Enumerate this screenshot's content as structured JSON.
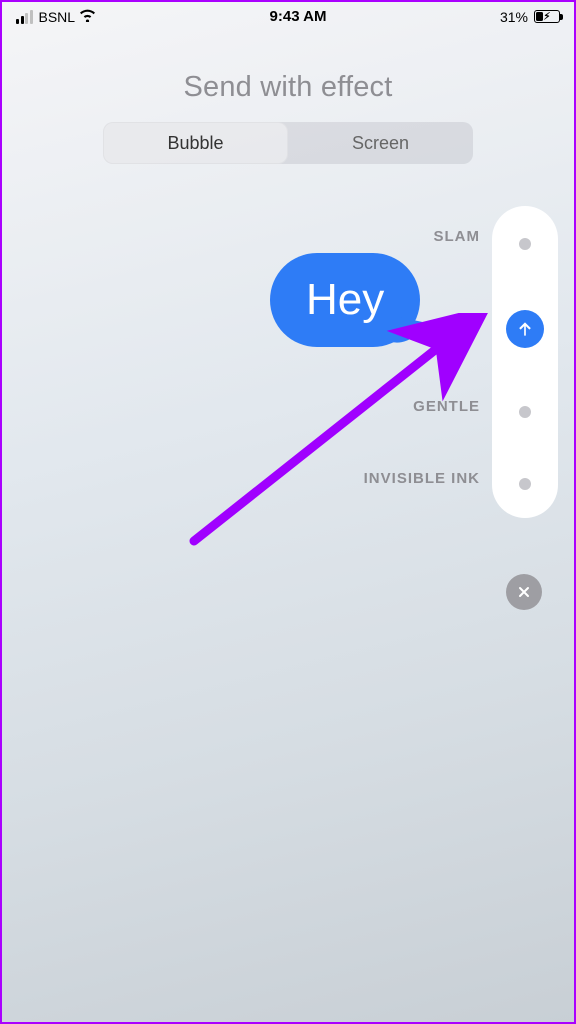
{
  "status_bar": {
    "carrier": "BSNL",
    "time": "9:43 AM",
    "battery_pct": "31%"
  },
  "title": "Send with effect",
  "segmented": {
    "bubble": "Bubble",
    "screen": "Screen"
  },
  "effects": {
    "slam": "SLAM",
    "gentle": "GENTLE",
    "invisible_ink": "INVISIBLE INK"
  },
  "message": {
    "text": "Hey"
  }
}
